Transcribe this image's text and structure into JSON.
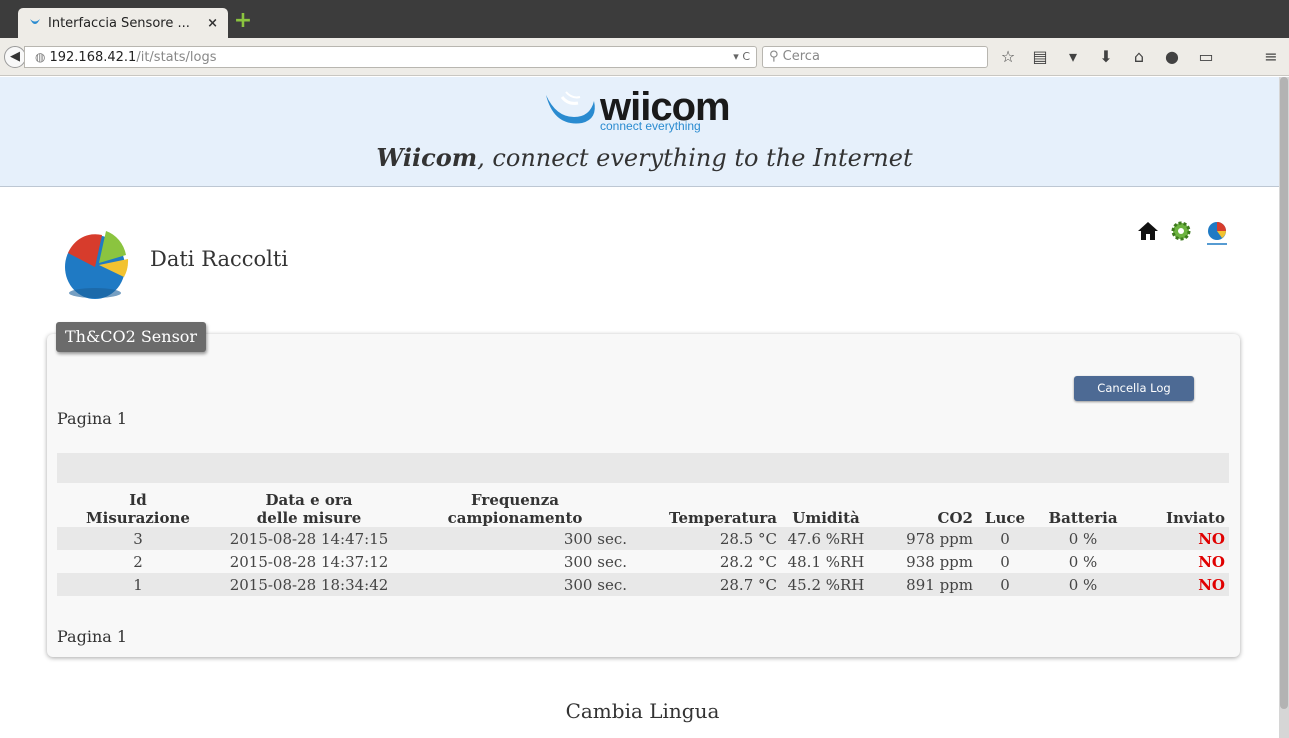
{
  "browser": {
    "tab_title": "Interfaccia Sensore ...",
    "url_host": "192.168.42.1",
    "url_path": "/it/stats/logs",
    "search_placeholder": "Cerca"
  },
  "header": {
    "logo_word": "wiicom",
    "logo_tagline": "connect everything",
    "tagline_brand": "Wiicom",
    "tagline_rest": ", connect everything to the Internet"
  },
  "section": {
    "title": "Dati Raccolti"
  },
  "panel": {
    "tab_label": "Th&CO2 Sensor",
    "clear_button": "Cancella Log",
    "page_top": "Pagina 1",
    "page_bottom": "Pagina 1"
  },
  "table": {
    "headers": {
      "id_line1": "Id",
      "id_line2": "Misurazione",
      "date_line1": "Data e ora",
      "date_line2": "delle misure",
      "freq_line1": "Frequenza",
      "freq_line2": "campionamento",
      "temperature": "Temperatura",
      "humidity": "Umidità",
      "co2": "CO2",
      "light": "Luce",
      "battery": "Batteria",
      "sent": "Inviato"
    },
    "rows": [
      {
        "id": "3",
        "datetime": "2015-08-28 14:47:15",
        "frequency": "300 sec.",
        "temperature": "28.5 °C",
        "humidity": "47.6 %RH",
        "co2": "978 ppm",
        "light": "0",
        "battery": "0 %",
        "sent": "NO"
      },
      {
        "id": "2",
        "datetime": "2015-08-28 14:37:12",
        "frequency": "300 sec.",
        "temperature": "28.2 °C",
        "humidity": "48.1 %RH",
        "co2": "938 ppm",
        "light": "0",
        "battery": "0 %",
        "sent": "NO"
      },
      {
        "id": "1",
        "datetime": "2015-08-28 18:34:42",
        "frequency": "300 sec.",
        "temperature": "28.7 °C",
        "humidity": "45.2 %RH",
        "co2": "891 ppm",
        "light": "0",
        "battery": "0 %",
        "sent": "NO"
      }
    ]
  },
  "footer": {
    "change_language": "Cambia Lingua"
  },
  "colors": {
    "header_bg": "#e6f0fb",
    "button_bg": "#4d6a94",
    "sent_no": "#e00000",
    "brand_blue": "#2a8bd0"
  }
}
